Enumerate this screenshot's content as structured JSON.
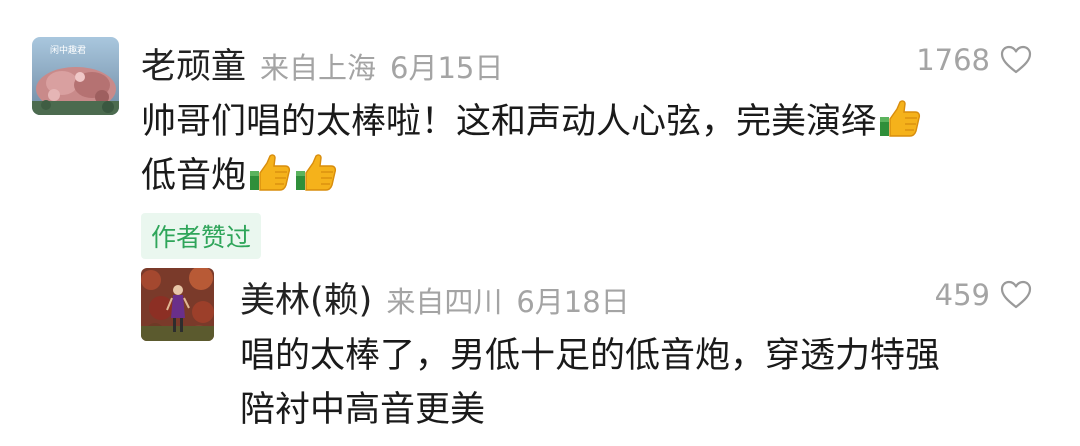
{
  "comment": {
    "username": "老顽童",
    "location": "来自上海",
    "date": "6月15日",
    "like_count": "1768",
    "text_line1": "帅哥们唱的太棒啦！这和声动人心弦，完美演绎",
    "text_line2": "低音炮",
    "author_liked": "作者赞过",
    "avatar_caption": "闲中趣君",
    "icons": [
      "heart-icon",
      "thumbs-up-icon"
    ]
  },
  "reply": {
    "username": "美林(赖)",
    "location": "来自四川",
    "date": "6月18日",
    "like_count": "459",
    "text_line1": "唱的太棒了，男低十足的低音炮，穿透力特强",
    "text_line2": "陪衬中高音更美",
    "icons": [
      "heart-icon"
    ]
  },
  "colors": {
    "meta_gray": "#a4a4a4",
    "author_liked_text": "#2fa55a",
    "author_liked_bg": "#eaf7ef"
  }
}
